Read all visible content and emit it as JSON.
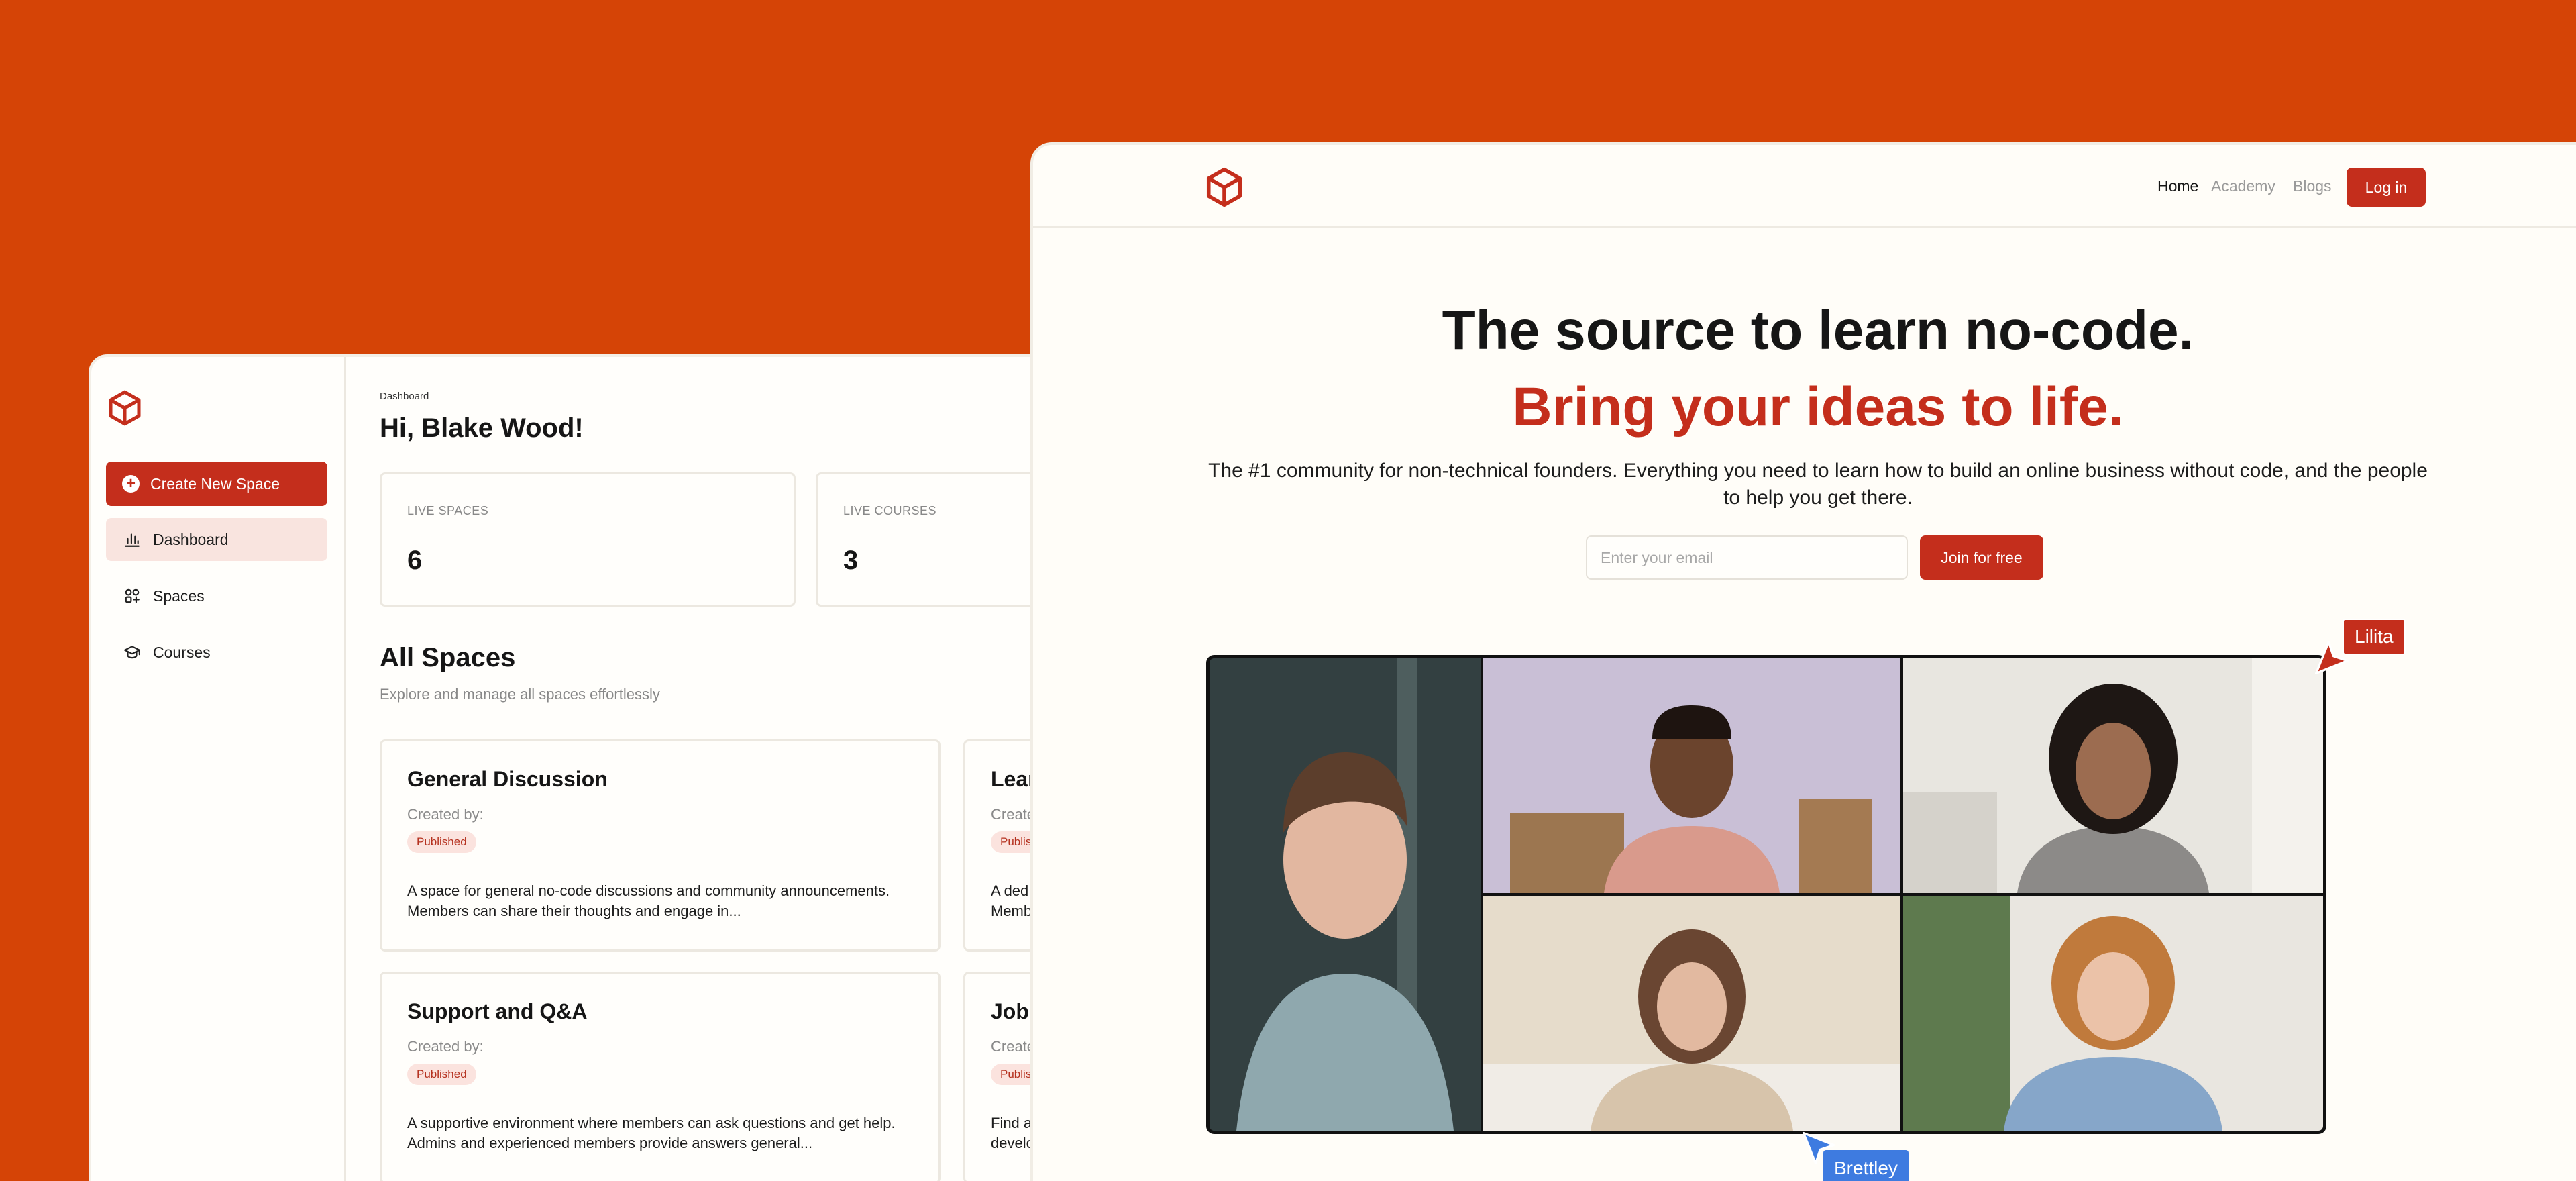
{
  "dashboard": {
    "create_button": "Create New Space",
    "nav": [
      {
        "label": "Dashboard",
        "icon": "bar-chart-icon",
        "active": true
      },
      {
        "label": "Spaces",
        "icon": "spaces-grid-icon",
        "active": false
      },
      {
        "label": "Courses",
        "icon": "graduation-cap-icon",
        "active": false
      }
    ],
    "breadcrumb": "Dashboard",
    "greeting": "Hi, Blake Wood!",
    "stats": [
      {
        "label": "LIVE SPACES",
        "value": "6"
      },
      {
        "label": "LIVE COURSES",
        "value": "3"
      }
    ],
    "section_title": "All Spaces",
    "section_subtitle": "Explore and manage all spaces effortlessly",
    "spaces": [
      {
        "title": "General Discussion",
        "created": "Created by:",
        "status": "Published",
        "description": "A space for general no-code discussions and community announcements. Members can share their thoughts and engage in..."
      },
      {
        "title": "Lear",
        "created": "Create",
        "status": "Publis",
        "description": "A ded Memb"
      },
      {
        "title": "Support and Q&A",
        "created": "Created by:",
        "status": "Published",
        "description": "A supportive environment where members can ask questions and get help. Admins and experienced members provide answers general..."
      },
      {
        "title": "Job",
        "created": "Create",
        "status": "Publis",
        "description": "Find a develo"
      }
    ]
  },
  "landing": {
    "nav": {
      "home": "Home",
      "academy": "Academy",
      "blogs": "Blogs",
      "login": "Log in"
    },
    "headline": "The source to learn no-code.",
    "headline_accent": "Bring your ideas to life.",
    "subheadline": "The #1 community for non-technical founders. Everything you need to learn how to build an online business without code, and the people to help you get there.",
    "email_placeholder": "Enter your email",
    "join_button": "Join for free",
    "cursor_tags": {
      "top": "Lilita",
      "bottom": "Brettley"
    }
  },
  "colors": {
    "background": "#D54406",
    "accent": "#C42E1C",
    "badge_bg": "#FBE3DE",
    "cursor_blue": "#3E7BE0"
  }
}
